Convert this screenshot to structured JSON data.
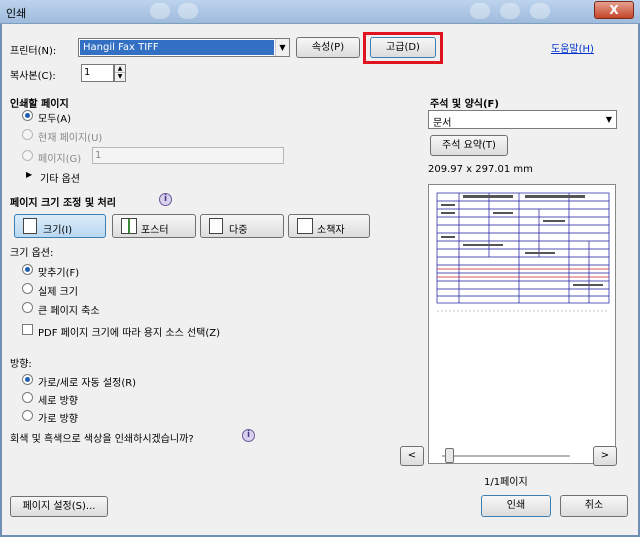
{
  "window": {
    "title": "인쇄",
    "close_label": "X"
  },
  "printer": {
    "label": "프린터(N):",
    "value": "Hangil Fax TIFF",
    "properties_button": "속성(P)",
    "advanced_button": "고급(D)",
    "help_link": "도움말(H)"
  },
  "copies": {
    "label": "복사본(C):",
    "value": "1"
  },
  "print_range": {
    "heading": "인쇄할 페이지",
    "all": "모두(A)",
    "current": "현재 페이지(U)",
    "pages": "페이지(G)",
    "pages_value": "1",
    "more": "기타 옵션"
  },
  "page_handling": {
    "heading": "페이지 크기 조정 및 처리",
    "buttons": [
      "크기(I)",
      "포스터",
      "다중",
      "소책자"
    ],
    "size_options_label": "크기 옵션:",
    "fit": "맞추기(F)",
    "actual": "실제 크기",
    "shrink": "큰 페이지 축소",
    "pdf_source": "PDF 페이지 크기에 따라 용지 소스 선택(Z)"
  },
  "orientation": {
    "label": "방향:",
    "auto": "가로/세로 자동 설정(R)",
    "portrait": "세로 방향",
    "landscape": "가로 방향"
  },
  "grayscale_question": "회색 및 흑색으로 색상을 인쇄하시겠습니까?",
  "comments_forms": {
    "heading": "주석 및 양식(F)",
    "value": "문서",
    "summarize_button": "주석 요약(T)",
    "size": "209.97 x 297.01 mm"
  },
  "preview": {
    "page_label": "1/1페이지",
    "prev": "<",
    "next": ">"
  },
  "footer": {
    "page_setup": "페이지 설정(S)...",
    "print": "인쇄",
    "cancel": "취소"
  },
  "colors": {
    "highlight": "#e0141e",
    "selection": "#3370c4"
  }
}
